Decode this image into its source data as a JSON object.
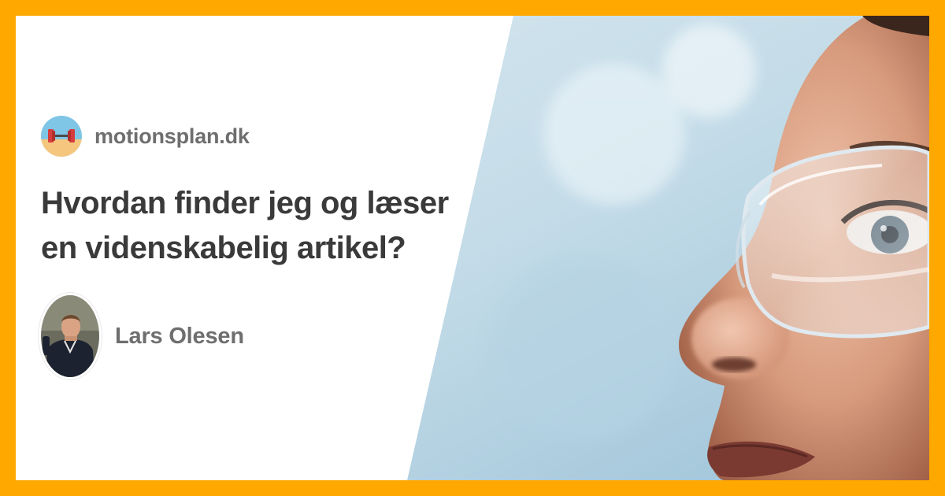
{
  "site": {
    "name": "motionsplan.dk",
    "logo_icon": "dumbbell-icon"
  },
  "article": {
    "title": "Hvordan finder jeg og læser en videnskabelig artikel?"
  },
  "author": {
    "name": "Lars Olesen"
  },
  "colors": {
    "frame": "#FFA800",
    "card_background": "#FFFFFF",
    "title_text": "#3A3A3A",
    "meta_text": "#6E6E6E"
  }
}
